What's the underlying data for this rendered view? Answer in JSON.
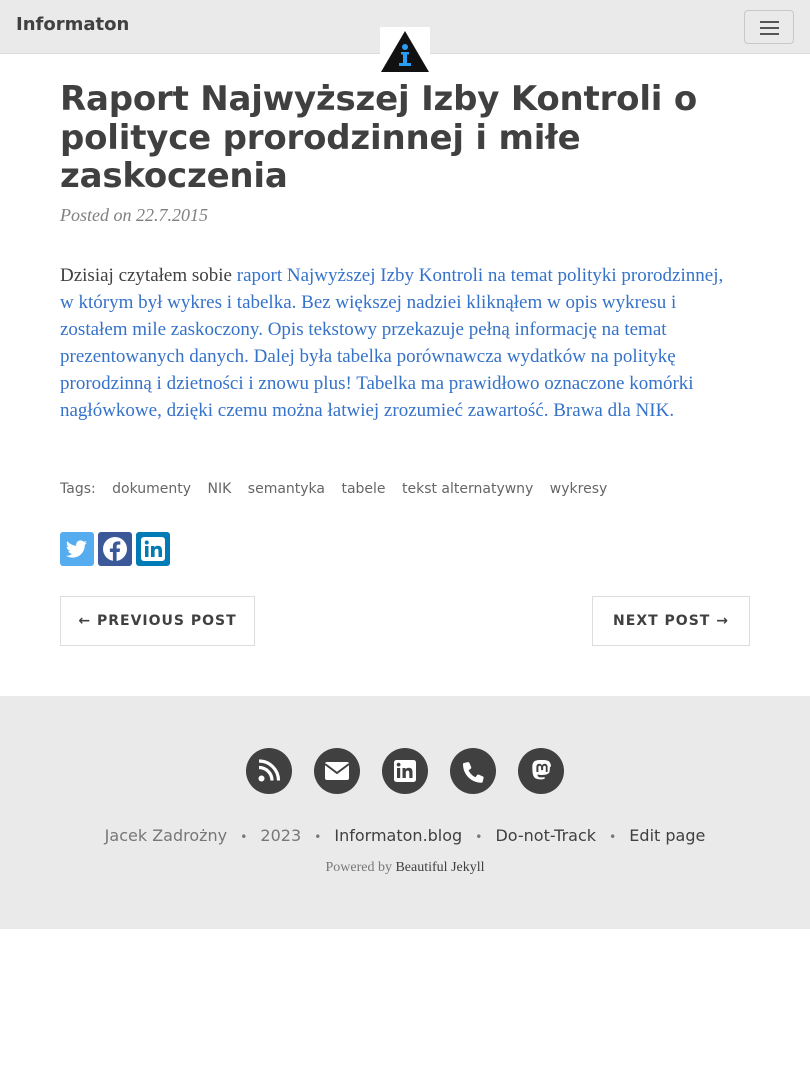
{
  "nav": {
    "brand": "Informaton",
    "menu_icon": "hamburger-icon",
    "logo_icon": "info-triangle-logo"
  },
  "post": {
    "title": "Raport Najwyższej Izby Kontroli o polityce prorodzinnej i miłe zaskoczenia",
    "meta": "Posted on 22.7.2015",
    "body_intro": "Dzisiaj czytałem sobie ",
    "body_link": "raport Najwyższej Izby Kontroli na temat polityki prorodzinnej, w którym był wykres i tabelka. Bez większej nadziei kliknąłem w opis wykresu i zostałem mile zaskoczony. Opis tekstowy przekazuje pełną informację na temat prezentowanych danych. Dalej była tabelka porównawcza wydatków na politykę prorodzinną i dzietności i znowu plus! Tabelka ma prawidłowo oznaczone komórki nagłówkowe, dzięki czemu można łatwiej zrozumieć zawartość. Brawa dla NIK."
  },
  "tags": {
    "label": "Tags:",
    "items": [
      "dokumenty",
      "NIK",
      "semantyka",
      "tabele",
      "tekst alternatywny",
      "wykresy"
    ]
  },
  "share": {
    "icons": [
      "twitter-icon",
      "facebook-icon",
      "linkedin-icon"
    ],
    "colors": {
      "twitter": "#55acee",
      "facebook": "#3b5998",
      "linkedin": "#007bb5"
    }
  },
  "pager": {
    "prev": "← PREVIOUS POST",
    "next": "NEXT POST →"
  },
  "footer": {
    "social_icons": [
      "rss-icon",
      "envelope-icon",
      "linkedin-icon",
      "phone-icon",
      "mastodon-icon"
    ],
    "author": "Jacek Zadrożny",
    "sep": "•",
    "year": "2023",
    "site": "Informaton.blog",
    "dnt": "Do-not-Track",
    "edit": "Edit page",
    "powered_prefix": "Powered by ",
    "powered_link": "Beautiful Jekyll"
  },
  "colors": {
    "link": "#3572c9",
    "text": "#404040",
    "footer_bg": "#eaeaea"
  }
}
